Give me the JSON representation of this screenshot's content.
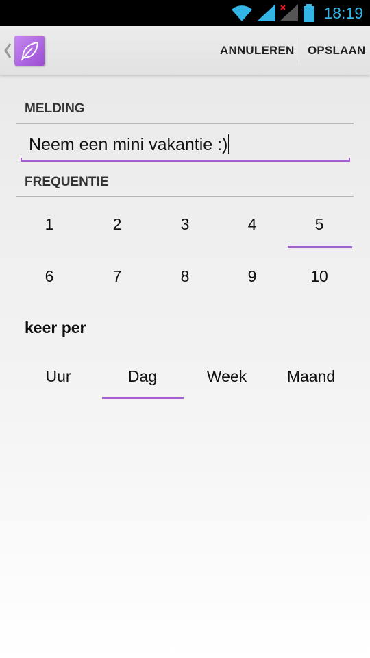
{
  "status_bar": {
    "time": "18:19",
    "time_color": "#33b5e5",
    "icons": [
      "wifi-icon",
      "signal-icon",
      "signal-no-service-icon",
      "battery-icon"
    ]
  },
  "action_bar": {
    "app_icon": "leaf-icon",
    "cancel_label": "ANNULEREN",
    "save_label": "OPSLAAN"
  },
  "notification": {
    "header": "MELDING",
    "value": "Neem een mini vakantie :)"
  },
  "frequency": {
    "header": "FREQUENTIE",
    "options": [
      "1",
      "2",
      "3",
      "4",
      "5",
      "6",
      "7",
      "8",
      "9",
      "10"
    ],
    "selected": "5"
  },
  "period": {
    "label": "keer per",
    "options": [
      "Uur",
      "Dag",
      "Week",
      "Maand"
    ],
    "selected": "Dag"
  },
  "accent_color": "#a25fcf"
}
